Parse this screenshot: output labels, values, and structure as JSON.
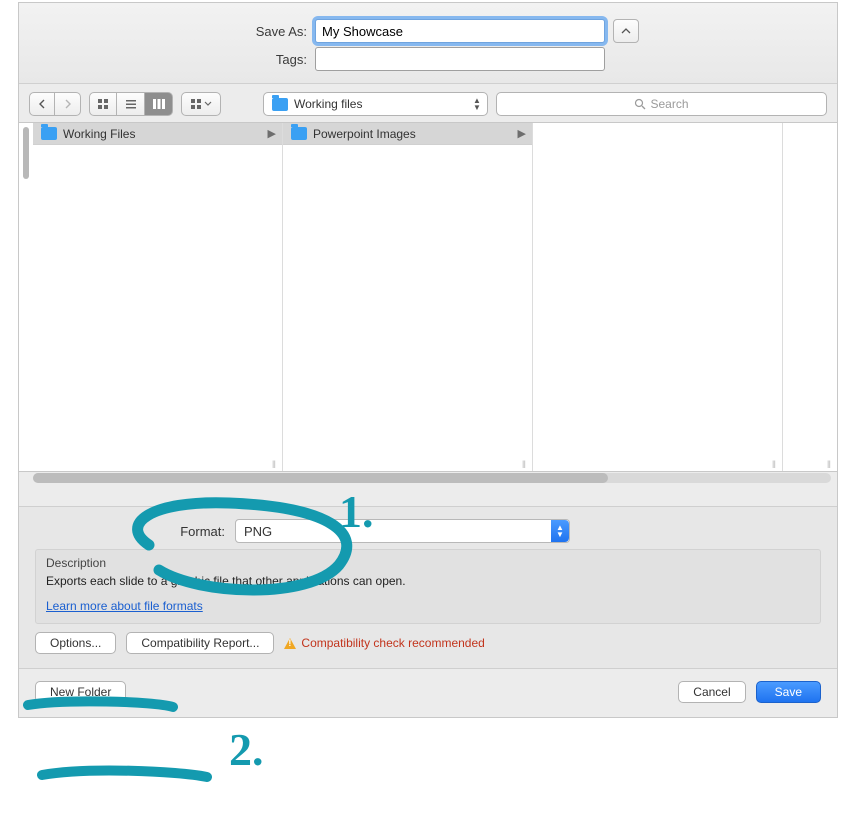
{
  "header": {
    "saveas_label": "Save As:",
    "saveas_value": "My Showcase",
    "tags_label": "Tags:",
    "tags_value": ""
  },
  "toolbar": {
    "folder_name": "Working files",
    "search_placeholder": "Search"
  },
  "columns": [
    {
      "name": "Working Files"
    },
    {
      "name": "Powerpoint Images"
    }
  ],
  "format": {
    "label": "Format:",
    "value": "PNG",
    "description_heading": "Description",
    "description_text": "Exports each slide to a graphic file that other applications can open.",
    "learn_link": "Learn more about file formats",
    "options_btn": "Options...",
    "compat_btn": "Compatibility Report...",
    "compat_warning": "Compatibility check recommended"
  },
  "footer": {
    "newfolder": "New Folder",
    "cancel": "Cancel",
    "save": "Save"
  },
  "annotations": {
    "one": "1.",
    "two": "2."
  }
}
